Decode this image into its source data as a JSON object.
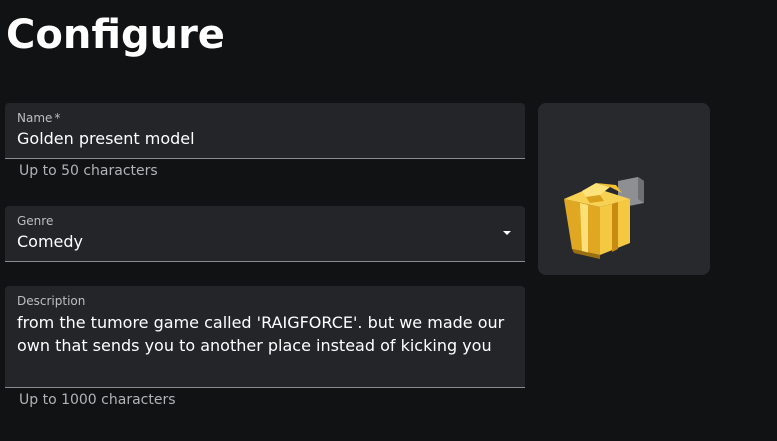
{
  "page": {
    "title": "Configure"
  },
  "form": {
    "name": {
      "label": "Name",
      "required_marker": "*",
      "value": "Golden present model",
      "helper": "Up to 50 characters"
    },
    "genre": {
      "label": "Genre",
      "selected": "Comedy"
    },
    "description": {
      "label": "Description",
      "value": "from the tumore game called 'RAIGFORCE'. but we made our own that sends you to another place instead of kicking you",
      "helper": "Up to 1000 characters"
    }
  },
  "preview": {
    "icon": "golden-present-model-thumbnail"
  },
  "colors": {
    "background": "#111214",
    "field_bg": "#242529",
    "preview_bg": "#28292d",
    "gold": "#f2c232"
  }
}
